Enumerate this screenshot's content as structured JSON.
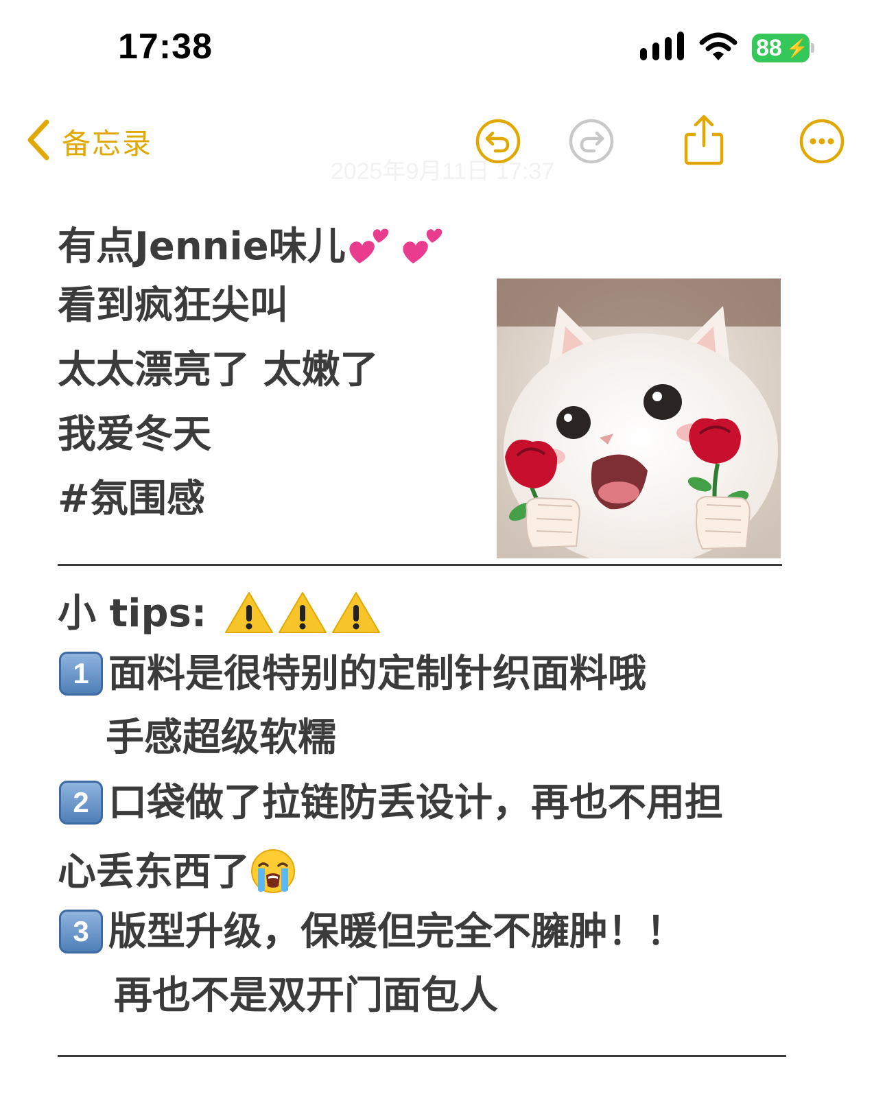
{
  "status_bar": {
    "time": "17:38",
    "battery": "88"
  },
  "nav": {
    "back_label": "备忘录",
    "date": "2025年9月11日 17:37"
  },
  "note": {
    "line1": "有点Jennie味儿",
    "line2": "看到疯狂尖叫",
    "line3": "太太漂亮了 太嫩了",
    "line4": "我爱冬天",
    "line5": "#氛围感",
    "tips_title": "小 tips:",
    "tip1_num": "1",
    "tip1_line1": "面料是很特别的定制针织面料哦",
    "tip1_line2": "手感超级软糯",
    "tip2_num": "2",
    "tip2_line1": "口袋做了拉链防丢设计，再也不用担",
    "tip2_line2": "心丢东西了",
    "tip3_num": "3",
    "tip3_line1": "版型升级，保暖但完全不臃肿！！",
    "tip3_line2": "再也不是双开门面包人"
  },
  "icons": {
    "back": "chevron-left-icon",
    "undo": "undo-icon",
    "redo": "redo-icon",
    "share": "share-icon",
    "more": "more-icon",
    "signal": "signal-icon",
    "wifi": "wifi-icon",
    "hearts": "two-hearts-emoji",
    "warning": "warning-emoji",
    "crying": "loudly-crying-face-emoji"
  },
  "colors": {
    "accent": "#e0a800",
    "text": "#3b3b3b",
    "battery": "#34c759",
    "keycap": "#5b88c0"
  }
}
